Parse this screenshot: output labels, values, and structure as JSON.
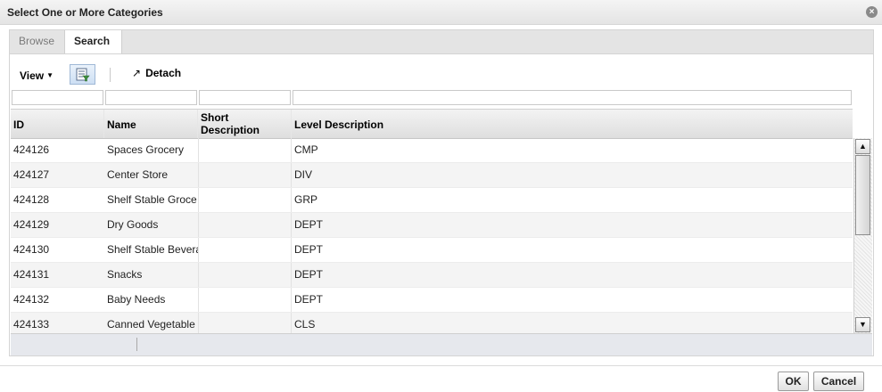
{
  "dialog": {
    "title": "Select One or More Categories",
    "close_icon": "close-icon"
  },
  "tabs": [
    {
      "label": "Browse",
      "selected": false
    },
    {
      "label": "Search",
      "selected": true
    }
  ],
  "toolbar": {
    "view_label": "View",
    "filter_icon": "query-by-example-icon",
    "detach_label": "Detach",
    "detach_icon": "↗"
  },
  "filters": {
    "id": "",
    "name": "",
    "short_description": "",
    "level_description": ""
  },
  "columns": [
    "ID",
    "Name",
    "Short Description",
    "Level Description"
  ],
  "rows": [
    {
      "id": "424126",
      "name": "Spaces Grocery",
      "short": "",
      "level": "CMP"
    },
    {
      "id": "424127",
      "name": "Center Store",
      "short": "",
      "level": "DIV"
    },
    {
      "id": "424128",
      "name": "Shelf Stable Groce",
      "short": "",
      "level": "GRP"
    },
    {
      "id": "424129",
      "name": "Dry Goods",
      "short": "",
      "level": "DEPT"
    },
    {
      "id": "424130",
      "name": "Shelf Stable Bevera",
      "short": "",
      "level": "DEPT"
    },
    {
      "id": "424131",
      "name": "Snacks",
      "short": "",
      "level": "DEPT"
    },
    {
      "id": "424132",
      "name": "Baby Needs",
      "short": "",
      "level": "DEPT"
    },
    {
      "id": "424133",
      "name": "Canned Vegetable",
      "short": "",
      "level": "CLS"
    }
  ],
  "buttons": {
    "ok": "OK",
    "cancel": "Cancel"
  }
}
